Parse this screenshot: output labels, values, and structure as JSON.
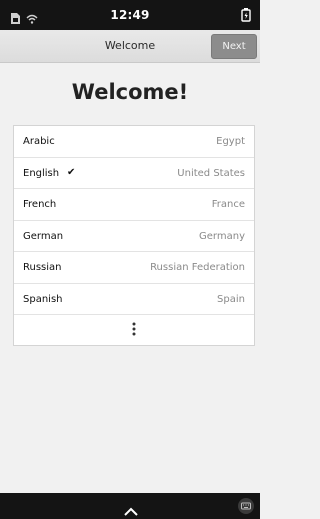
{
  "status_bar": {
    "time": "12:49",
    "icons": [
      "sim-card-icon",
      "wifi-icon",
      "battery-icon"
    ]
  },
  "header": {
    "title": "Welcome",
    "next_label": "Next"
  },
  "main": {
    "heading": "Welcome!"
  },
  "languages": [
    {
      "name": "Arabic",
      "region": "Egypt",
      "selected": false
    },
    {
      "name": "English",
      "region": "United States",
      "selected": true
    },
    {
      "name": "French",
      "region": "France",
      "selected": false
    },
    {
      "name": "German",
      "region": "Germany",
      "selected": false
    },
    {
      "name": "Russian",
      "region": "Russian Federation",
      "selected": false
    },
    {
      "name": "Spanish",
      "region": "Spain",
      "selected": false
    }
  ],
  "selected_mark": "✔",
  "more_icon": "more-vertical-icon",
  "bottom_bar": {
    "icons": [
      "chevron-up-icon",
      "keyboard-icon"
    ]
  },
  "colors": {
    "status_bar_bg": "#141414",
    "header_bg": "#e0e0e0",
    "next_button_bg": "#8c8c8c",
    "page_bg": "#f1f1f1",
    "region_text": "#8a8a8a"
  }
}
